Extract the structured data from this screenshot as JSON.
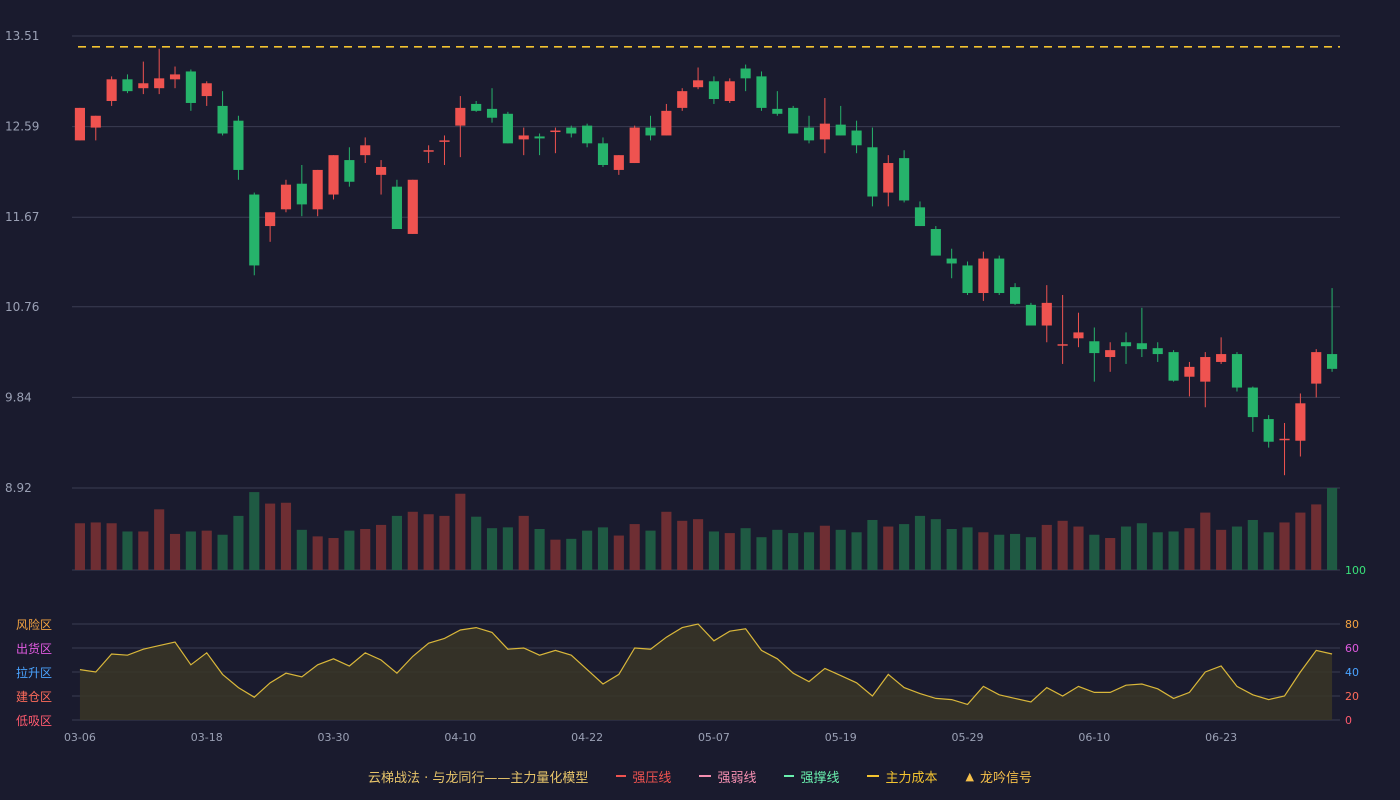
{
  "chart_data": {
    "type": "candlestick",
    "price_axis": {
      "ticks": [
        "13.51",
        "12.59",
        "11.67",
        "10.76",
        "9.84",
        "8.92"
      ],
      "ylim": [
        8.92,
        13.51
      ]
    },
    "main_cost_line": 13.4,
    "dates": [
      "03-06",
      "03-18",
      "03-30",
      "04-10",
      "04-22",
      "05-07",
      "05-19",
      "05-29",
      "06-10",
      "06-23"
    ],
    "date_tick_indices": [
      0,
      8,
      16,
      24,
      32,
      40,
      48,
      56,
      64,
      72
    ],
    "ohlc": [
      [
        12.45,
        12.78,
        12.45,
        12.78
      ],
      [
        12.58,
        12.7,
        12.45,
        12.7
      ],
      [
        12.85,
        13.1,
        12.8,
        13.07
      ],
      [
        13.07,
        13.12,
        12.93,
        12.95
      ],
      [
        12.98,
        13.25,
        12.92,
        13.03
      ],
      [
        12.98,
        13.38,
        12.92,
        13.08
      ],
      [
        13.07,
        13.2,
        12.98,
        13.12
      ],
      [
        13.15,
        13.17,
        12.75,
        12.83
      ],
      [
        12.9,
        13.05,
        12.8,
        13.03
      ],
      [
        12.8,
        12.95,
        12.5,
        12.52
      ],
      [
        12.65,
        12.7,
        12.05,
        12.15
      ],
      [
        11.9,
        11.92,
        11.08,
        11.18
      ],
      [
        11.58,
        11.72,
        11.42,
        11.72
      ],
      [
        11.75,
        12.05,
        11.72,
        12.0
      ],
      [
        12.01,
        12.2,
        11.68,
        11.8
      ],
      [
        11.75,
        12.15,
        11.68,
        12.15
      ],
      [
        11.9,
        12.3,
        11.85,
        12.3
      ],
      [
        12.25,
        12.38,
        11.98,
        12.03
      ],
      [
        12.3,
        12.48,
        12.22,
        12.4
      ],
      [
        12.1,
        12.25,
        11.9,
        12.18
      ],
      [
        11.98,
        12.05,
        11.55,
        11.55
      ],
      [
        11.5,
        12.05,
        11.5,
        12.05
      ],
      [
        12.35,
        12.4,
        12.22,
        12.35
      ],
      [
        12.45,
        12.5,
        12.2,
        12.45
      ],
      [
        12.6,
        12.9,
        12.28,
        12.78
      ],
      [
        12.82,
        12.85,
        12.74,
        12.75
      ],
      [
        12.77,
        12.98,
        12.63,
        12.68
      ],
      [
        12.72,
        12.74,
        12.42,
        12.42
      ],
      [
        12.46,
        12.58,
        12.3,
        12.5
      ],
      [
        12.49,
        12.52,
        12.3,
        12.47
      ],
      [
        12.55,
        12.58,
        12.32,
        12.55
      ],
      [
        12.58,
        12.6,
        12.48,
        12.52
      ],
      [
        12.6,
        12.62,
        12.38,
        12.42
      ],
      [
        12.42,
        12.48,
        12.18,
        12.2
      ],
      [
        12.15,
        12.3,
        12.1,
        12.3
      ],
      [
        12.22,
        12.6,
        12.22,
        12.58
      ],
      [
        12.58,
        12.7,
        12.45,
        12.5
      ],
      [
        12.5,
        12.82,
        12.5,
        12.75
      ],
      [
        12.78,
        12.98,
        12.75,
        12.95
      ],
      [
        12.99,
        13.19,
        12.97,
        13.06
      ],
      [
        13.05,
        13.1,
        12.82,
        12.87
      ],
      [
        12.85,
        13.08,
        12.83,
        13.05
      ],
      [
        13.18,
        13.22,
        12.95,
        13.08
      ],
      [
        13.1,
        13.15,
        12.75,
        12.78
      ],
      [
        12.77,
        12.95,
        12.7,
        12.72
      ],
      [
        12.78,
        12.8,
        12.52,
        12.52
      ],
      [
        12.58,
        12.7,
        12.42,
        12.45
      ],
      [
        12.46,
        12.88,
        12.32,
        12.62
      ],
      [
        12.61,
        12.8,
        12.5,
        12.5
      ],
      [
        12.55,
        12.65,
        12.32,
        12.4
      ],
      [
        12.38,
        12.58,
        11.78,
        11.88
      ],
      [
        11.92,
        12.3,
        11.78,
        12.22
      ],
      [
        12.27,
        12.35,
        11.82,
        11.84
      ],
      [
        11.77,
        11.83,
        11.58,
        11.58
      ],
      [
        11.55,
        11.58,
        11.3,
        11.28
      ],
      [
        11.25,
        11.35,
        11.05,
        11.2
      ],
      [
        11.18,
        11.22,
        10.88,
        10.9
      ],
      [
        10.9,
        11.32,
        10.82,
        11.25
      ],
      [
        11.25,
        11.28,
        10.88,
        10.9
      ],
      [
        10.96,
        11.0,
        10.78,
        10.79
      ],
      [
        10.78,
        10.8,
        10.58,
        10.57
      ],
      [
        10.57,
        10.98,
        10.4,
        10.8
      ],
      [
        10.38,
        10.88,
        10.18,
        10.38
      ],
      [
        10.44,
        10.7,
        10.35,
        10.5
      ],
      [
        10.41,
        10.55,
        10.0,
        10.29
      ],
      [
        10.25,
        10.4,
        10.1,
        10.32
      ],
      [
        10.4,
        10.5,
        10.18,
        10.36
      ],
      [
        10.39,
        10.75,
        10.25,
        10.33
      ],
      [
        10.34,
        10.4,
        10.2,
        10.28
      ],
      [
        10.3,
        10.32,
        10.0,
        10.01
      ],
      [
        10.05,
        10.2,
        9.85,
        10.15
      ],
      [
        10.0,
        10.3,
        9.74,
        10.25
      ],
      [
        10.2,
        10.45,
        10.18,
        10.28
      ],
      [
        10.28,
        10.3,
        9.9,
        9.94
      ],
      [
        9.94,
        9.95,
        9.49,
        9.64
      ],
      [
        9.62,
        9.66,
        9.33,
        9.39
      ],
      [
        9.41,
        9.58,
        9.05,
        9.42
      ],
      [
        9.4,
        9.88,
        9.24,
        9.78
      ],
      [
        9.98,
        10.33,
        9.84,
        10.3
      ],
      [
        10.28,
        10.95,
        10.1,
        10.13
      ]
    ],
    "volume": [
      0.57,
      0.58,
      0.57,
      0.47,
      0.47,
      0.74,
      0.44,
      0.47,
      0.48,
      0.43,
      0.66,
      0.95,
      0.81,
      0.82,
      0.49,
      0.41,
      0.39,
      0.48,
      0.5,
      0.55,
      0.66,
      0.71,
      0.68,
      0.66,
      0.93,
      0.65,
      0.51,
      0.52,
      0.66,
      0.5,
      0.37,
      0.38,
      0.48,
      0.52,
      0.42,
      0.56,
      0.48,
      0.71,
      0.6,
      0.62,
      0.47,
      0.45,
      0.51,
      0.4,
      0.49,
      0.45,
      0.46,
      0.54,
      0.49,
      0.46,
      0.61,
      0.53,
      0.56,
      0.66,
      0.62,
      0.5,
      0.52,
      0.46,
      0.43,
      0.44,
      0.4,
      0.55,
      0.6,
      0.53,
      0.43,
      0.39,
      0.53,
      0.57,
      0.46,
      0.47,
      0.51,
      0.7,
      0.49,
      0.53,
      0.61,
      0.46,
      0.58,
      0.7,
      0.8,
      1.0
    ],
    "indicator": {
      "ylim": [
        0,
        100
      ],
      "ticks": [
        "100",
        "80",
        "60",
        "40",
        "20",
        "0"
      ],
      "zones": [
        "风险区",
        "出货区",
        "拉升区",
        "建仓区",
        "低吸区"
      ],
      "values": [
        42,
        40,
        55,
        54,
        59,
        62,
        65,
        46,
        56,
        38,
        27,
        19,
        31,
        39,
        36,
        46,
        51,
        45,
        56,
        50,
        39,
        53,
        64,
        68,
        75,
        77,
        73,
        59,
        60,
        54,
        58,
        54,
        42,
        30,
        38,
        60,
        59,
        69,
        77,
        80,
        66,
        74,
        76,
        58,
        51,
        39,
        32,
        43,
        37,
        31,
        20,
        38,
        27,
        22,
        18,
        17,
        13,
        28,
        21,
        18,
        15,
        27,
        20,
        28,
        23,
        23,
        29,
        30,
        26,
        18,
        23,
        40,
        45,
        28,
        21,
        17,
        20,
        40,
        58,
        55
      ]
    }
  },
  "legend": {
    "title": "云梯战法 · 与龙同行——主力量化模型",
    "items": [
      {
        "label": "强压线",
        "color": "#ef5350",
        "style": "solid"
      },
      {
        "label": "强弱线",
        "color": "#f48fb1",
        "style": "dash"
      },
      {
        "label": "强撑线",
        "color": "#69f0ae",
        "style": "solid"
      },
      {
        "label": "主力成本",
        "color": "#f4c430",
        "style": "dash"
      },
      {
        "label": "龙吟信号",
        "color": "#f6c04a",
        "style": "triangle"
      }
    ]
  },
  "colors": {
    "up": "#ef5350",
    "down": "#26b36b",
    "up_volume": "#6e2e33",
    "down_volume": "#1f5a43",
    "indicator_line": "#d9b73a",
    "indicator_fill": "#3a3526",
    "zone_risk": "#f4a340",
    "zone_distribute": "#e05ae0",
    "zone_lift": "#4aa3ff",
    "zone_build": "#ff6b5a",
    "zone_buy": "#ff5a6e",
    "tick_100": "#39e27a",
    "tick_80": "#f4a340",
    "tick_60": "#e05ae0",
    "tick_40": "#4aa3ff",
    "tick_20": "#ff6b5a",
    "tick_0": "#ff5a6e"
  }
}
